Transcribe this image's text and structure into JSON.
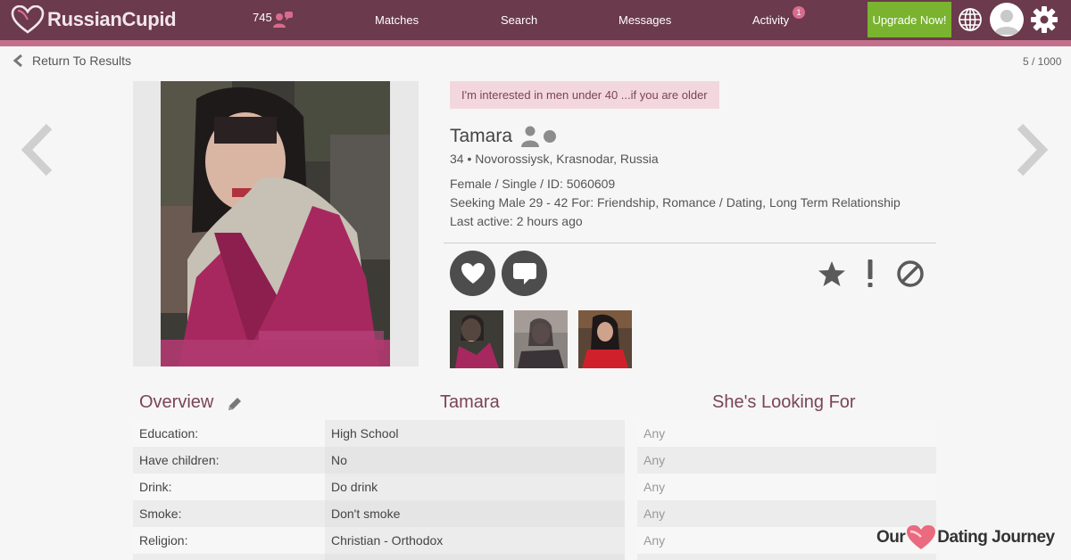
{
  "header": {
    "brand": "RussianCupid",
    "count": "745",
    "nav": [
      "Matches",
      "Search",
      "Messages",
      "Activity"
    ],
    "activity_badge": "1",
    "upgrade_label": "Upgrade Now!",
    "colors": {
      "bar": "#6b3a4c",
      "stripe": "#c3708c",
      "upgrade": "#79b32f"
    }
  },
  "subheader": {
    "back_label": "Return To Results",
    "pager": "5 / 1000"
  },
  "profile": {
    "note": "I'm interested in men under 40 ...if you are older",
    "name": "Tamara",
    "location": "34 • Novorossiysk, Krasnodar, Russia",
    "details": "Female / Single / ID: 5060609",
    "seeking": "Seeking Male 29 - 42 For: Friendship, Romance / Dating, Long Term Relationship",
    "last_active": "Last active: 2 hours ago"
  },
  "overview": {
    "headers": [
      "Overview",
      "Tamara",
      "She's Looking For"
    ],
    "rows": [
      {
        "label": "Education:",
        "value": "High School",
        "seek": "Any"
      },
      {
        "label": "Have children:",
        "value": "No",
        "seek": "Any"
      },
      {
        "label": "Drink:",
        "value": "Do drink",
        "seek": "Any"
      },
      {
        "label": "Smoke:",
        "value": "Don't smoke",
        "seek": "Any"
      },
      {
        "label": "Religion:",
        "value": "Christian - Orthodox",
        "seek": "Any"
      }
    ]
  },
  "watermark": {
    "left": "Our",
    "right": "Dating Journey"
  },
  "icons": [
    "heart-logo-icon",
    "users-icon",
    "globe-icon",
    "avatar-icon",
    "gear-icon",
    "chevron-left-icon",
    "chevron-right-icon",
    "person-icon",
    "heart-icon",
    "chat-icon",
    "star-icon",
    "exclamation-icon",
    "block-icon",
    "pencil-icon"
  ]
}
